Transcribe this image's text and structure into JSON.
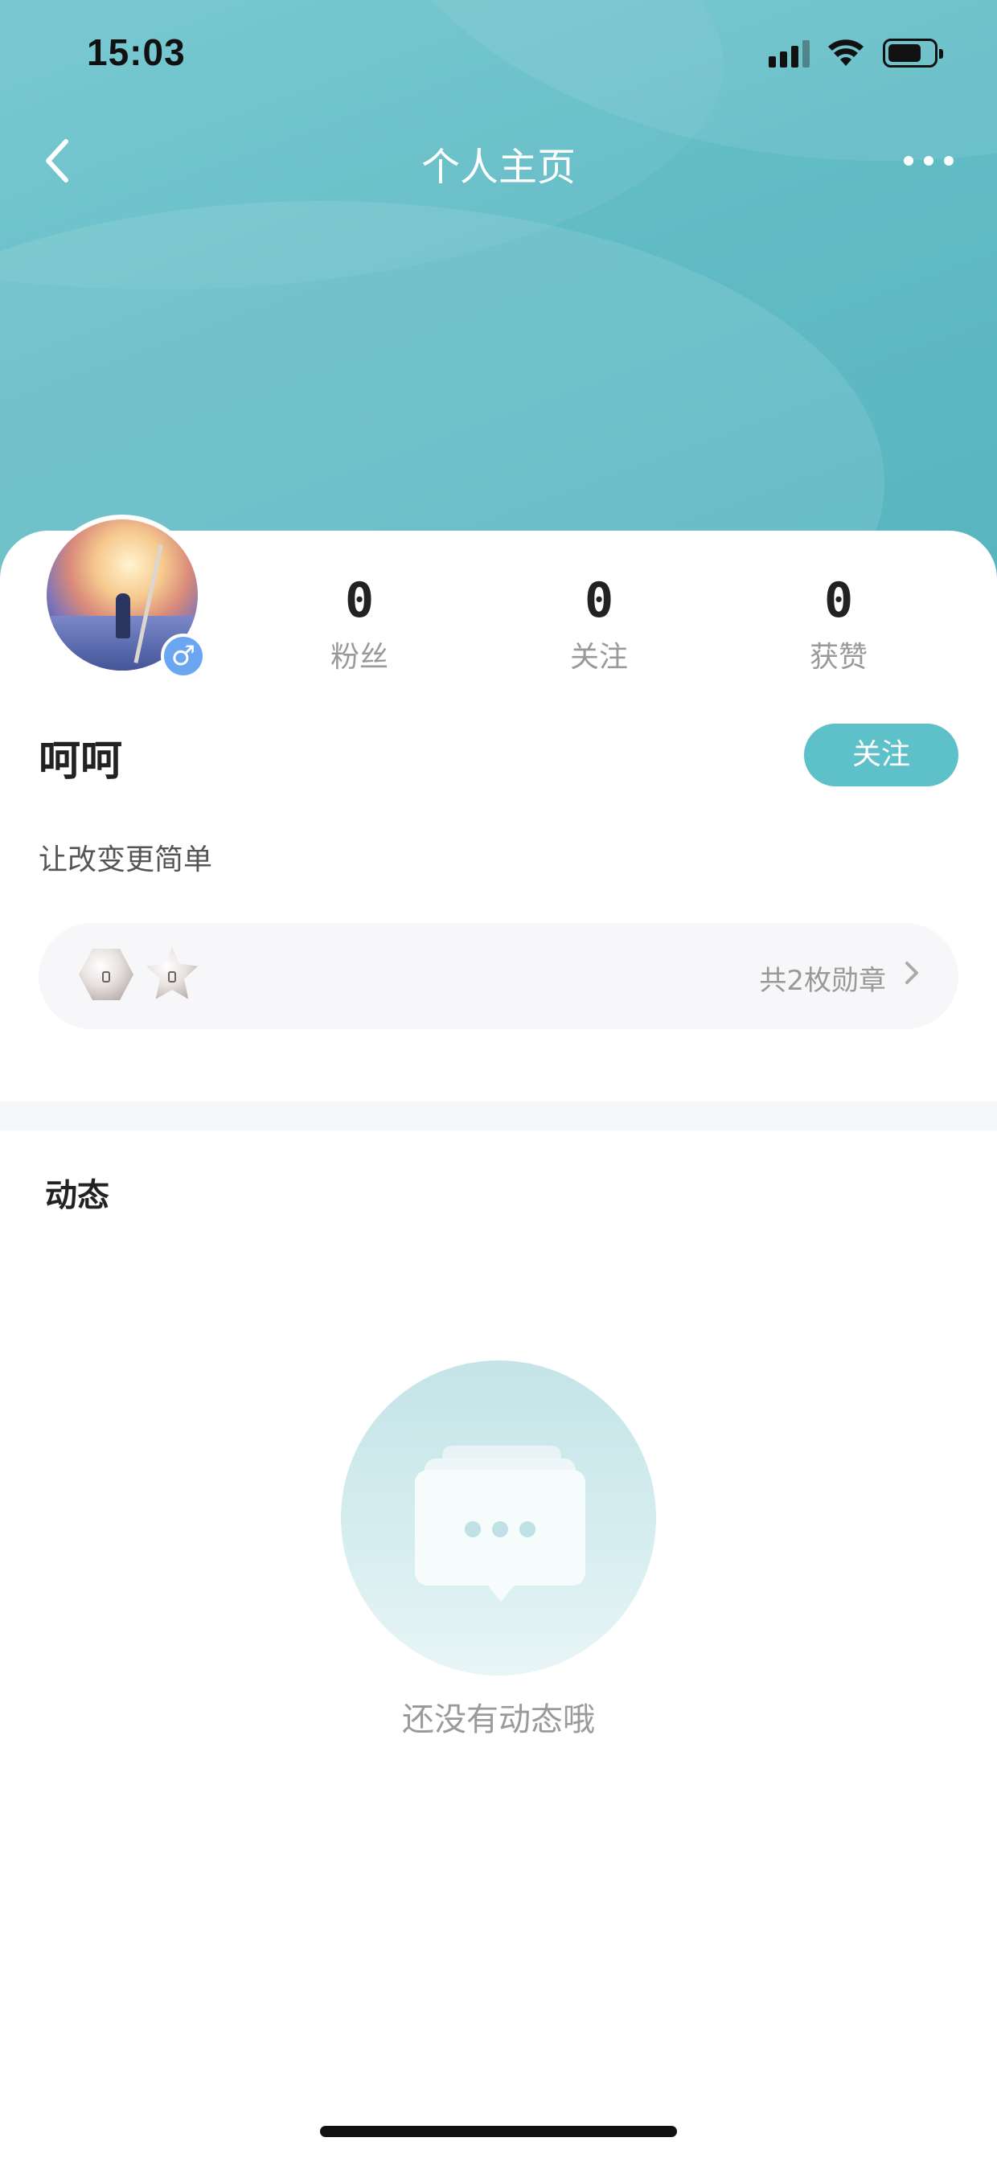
{
  "status_bar": {
    "time": "15:03"
  },
  "nav": {
    "title": "个人主页"
  },
  "profile": {
    "name": "呵呵",
    "bio": "让改变更简单",
    "gender_symbol": "♂",
    "follow_label": "关注"
  },
  "stats": [
    {
      "value": "0",
      "label": "粉丝"
    },
    {
      "value": "0",
      "label": "关注"
    },
    {
      "value": "0",
      "label": "获赞"
    }
  ],
  "medals": {
    "count_text": "共2枚勋章",
    "icons": [
      "hexagon-medal-icon",
      "star-medal-icon"
    ]
  },
  "feed": {
    "section_title": "动态",
    "empty_text": "还没有动态哦"
  },
  "colors": {
    "accent": "#5ec0c8",
    "header_bg": "#62bcc6",
    "gender_badge": "#6aa6f1"
  }
}
